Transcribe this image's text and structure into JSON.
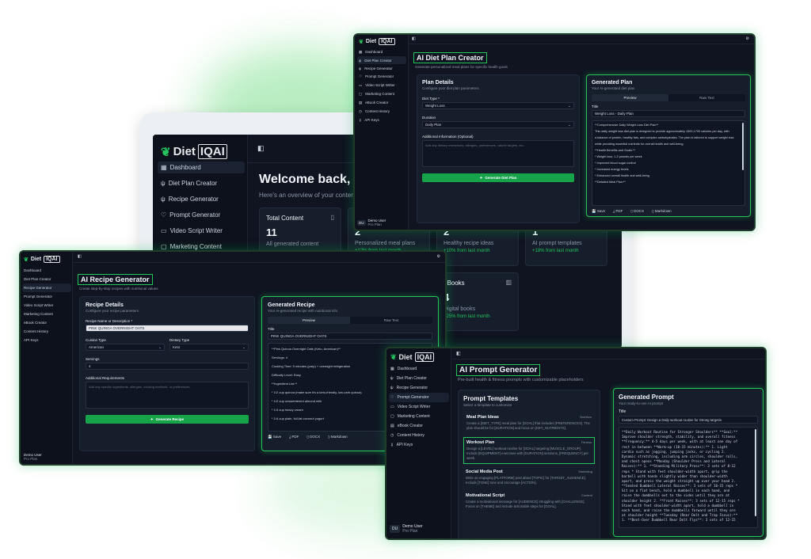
{
  "colors": {
    "accent": "#22c55e",
    "bg": "#0f1420",
    "panel": "#161d2b"
  },
  "brand": {
    "name_a": "Diet",
    "name_b": "IQAI"
  },
  "nav_items": [
    "Dashboard",
    "Diet Plan Creator",
    "Recipe Generator",
    "Prompt Generator",
    "Video Script Writer",
    "Marketing Content",
    "eBook Creator",
    "Content History",
    "API Keys"
  ],
  "user": {
    "initials": "DU",
    "name": "Demo User",
    "plan": "Pro Plan"
  },
  "dashboard": {
    "welcome": "Welcome back, Den",
    "subtitle": "Here's an overview of your content",
    "cards": [
      {
        "title": "Total Content",
        "value": "11",
        "desc": "All generated content",
        "trend": ""
      },
      {
        "title": "",
        "value": "2",
        "desc": "Personalized meal plans",
        "trend": "+12% from last month"
      },
      {
        "title": "",
        "value": "2",
        "desc": "Healthy recipe ideas",
        "trend": "+10% from last month"
      },
      {
        "title": "",
        "value": "1",
        "desc": "AI prompt templates",
        "trend": "+18% from last month"
      },
      {
        "title": "eBooks",
        "value": "4",
        "desc": "Digital books",
        "trend": "+25% from last month"
      }
    ]
  },
  "diet": {
    "title": "AI Diet Plan Creator",
    "subtitle": "Generate personalized meal plans for specific health goals",
    "details_title": "Plan Details",
    "details_sub": "Configure your diet plan parameters",
    "diet_type_label": "Diet Type *",
    "diet_type_value": "Weight Loss",
    "duration_label": "Duration",
    "duration_value": "Daily Plan",
    "addl_label": "Additional Information (Optional)",
    "addl_placeholder": "Add any dietary restrictions, allergies, preferences, calorie targets, etc.",
    "button": "Generate Diet Plan",
    "gen_title": "Generated Plan",
    "gen_sub": "Your AI-generated diet plan",
    "tab_preview": "Preview",
    "tab_raw": "Raw Text",
    "title_label": "Title",
    "title_value": "Weight Loss - Daily Plan",
    "lines": [
      "**Comprehensive Daily Weight Loss Diet Plan**",
      "This daily weight loss diet plan is designed to provide approximately 1500-1700 calories per day, with",
      "a balance of protein, healthy fats, and complex carbohydrates. The plan is tailored to support weight loss",
      "while providing essential nutrients for overall health and well-being.",
      "**Health Benefits and Goals:**",
      "* Weight loss: 1-2 pounds per week",
      "* Improved blood sugar control",
      "* Increased energy levels",
      "* Enhanced overall health and well-being",
      "**Detailed Meal Plan:**"
    ],
    "actions": [
      "Save",
      "PDF",
      "DOCX",
      "Markdown"
    ]
  },
  "recipe": {
    "title": "AI Recipe Generator",
    "subtitle": "Create step-by-step recipes with nutritional values",
    "details_title": "Recipe Details",
    "details_sub": "Configure your recipe parameters",
    "name_label": "Recipe Name or Description *",
    "name_value": "PINK QUINOA OVERNIGHT OATS",
    "cuisine_label": "Cuisine Type",
    "cuisine_value": "American",
    "dietary_label": "Dietary Type",
    "dietary_value": "Keto",
    "servings_label": "Servings",
    "servings_value": "4",
    "req_label": "Additional Requirements",
    "req_placeholder": "Add any specific ingredients, allergies, cooking methods, or preferences",
    "button": "Generate Recipe",
    "gen_title": "Generated Recipe",
    "gen_sub": "Your AI-generated recipe with nutritional info",
    "tab_preview": "Preview",
    "tab_raw": "Raw Text",
    "title_label": "Title",
    "title_value": "PINK QUINOA OVERNIGHT OATS",
    "lines": [
      "**Pink Quinoa Overnight Oats (Keto, American)**",
      "Servings: 4",
      "Cooking Time: 5 minutes (prep) + overnight refrigeration",
      "Difficulty Level: Easy",
      "**Ingredient List:**",
      "* 1/2 cup quinoa (make sure it's a keto-friendly, low-carb quinoa)",
      "* 1/2 cup unsweetened almond milk",
      "* 1/4 cup heavy cream",
      "* 1/4 cup plain, full-fat coconut yogurt"
    ],
    "actions": [
      "Save",
      "PDF",
      "DOCX",
      "Markdown"
    ]
  },
  "prompt": {
    "title": "AI Prompt Generator",
    "subtitle": "Pre-built health & fitness prompts with customizable placeholders",
    "templates_title": "Prompt Templates",
    "templates_sub": "Select a template to customize",
    "templates": [
      {
        "name": "Meal Plan Ideas",
        "tag": "Nutrition",
        "desc": "Create a [DIET_TYPE] meal plan for [GOAL] that includes [PREFERENCES]. The plan should be for [DURATION] and focus on [KEY_NUTRIENTS]."
      },
      {
        "name": "Workout Plan",
        "tag": "Fitness",
        "desc": "Design a [LEVEL] workout routine for [GOAL] targeting [MUSCLE_GROUP]. Include [EQUIPMENT] exercises with [DURATION] sessions, [FREQUENCY] per week."
      },
      {
        "name": "Social Media Post",
        "tag": "Marketing",
        "desc": "Write an engaging [PLATFORM] post about [TOPIC] for [TARGET_AUDIENCE]. Include [TONE] tone and encourage [ACTION]."
      },
      {
        "name": "Motivational Script",
        "tag": "Content",
        "desc": "Create a motivational message for [AUDIENCE] struggling with [CHALLENGE]. Focus on [THEME] and include actionable steps for [GOAL]."
      }
    ],
    "gen_title": "Generated Prompt",
    "gen_sub": "Your ready-to-use AI prompt",
    "title_label": "Title",
    "title_value": "Custom Prompt: Design a Daily workout routine for Strong targetin",
    "lines": [
      "**Daily Workout Routine for Stronger Shoulders** **Goal:**",
      "Improve shoulder strength, stability, and overall fitness",
      "**Frequency:** 4-5 days per week, with at least one day of",
      "rest in between **Warm-up (10-15 minutes):** 1. Light",
      "cardio such as jogging, jumping jacks, or cycling 2.",
      "Dynamic stretching, including arm circles, shoulder rolls,",
      "and chest opens **Monday (Shoulder Press and Lateral",
      "Raises):** 1. **Standing Military Press**: 3 sets of 8-12",
      "reps * Stand with feet shoulder-width apart, grip the",
      "barbell with hands slightly wider than shoulder-width",
      "apart, and press the weight straight up over your head 2.",
      "**Seated Dumbbell Lateral Raises**: 3 sets of 10-15 reps *",
      "Sit on a flat bench, hold a dumbbell in each hand, and",
      "raise the dumbbells out to the sides until they are at",
      "shoulder height 2. **Front Raises**: 3 sets of 12-15 reps *",
      "Stand with feet shoulder-width apart, hold a dumbbell in",
      "each hand, and raise the dumbbells forward until they are",
      "at shoulder height **Tuesday (Rear Delt and Trap Focus):**",
      "1. **Bent-Over Dumbbell Rear Delt Flys**: 3 sets of 12-15"
    ]
  }
}
